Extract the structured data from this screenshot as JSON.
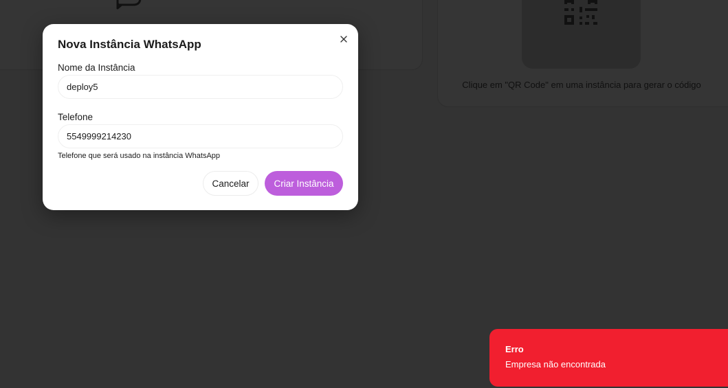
{
  "background": {
    "qr_hint": "Clique em \"QR Code\" em uma instância para gerar o código"
  },
  "modal": {
    "title": "Nova Instância WhatsApp",
    "name_field": {
      "label": "Nome da Instância",
      "value": "deploy5"
    },
    "phone_field": {
      "label": "Telefone",
      "value": "5549999214230",
      "help": "Telefone que será usado na instância WhatsApp"
    },
    "cancel_label": "Cancelar",
    "create_label": "Criar Instância"
  },
  "toast": {
    "title": "Erro",
    "message": "Empresa não encontrada"
  },
  "colors": {
    "overlay": "#333333",
    "accent": "#bd5edc",
    "error": "#f11f2f"
  },
  "icons": [
    "chat-bubble-icon",
    "qr-code-icon",
    "close-icon"
  ]
}
